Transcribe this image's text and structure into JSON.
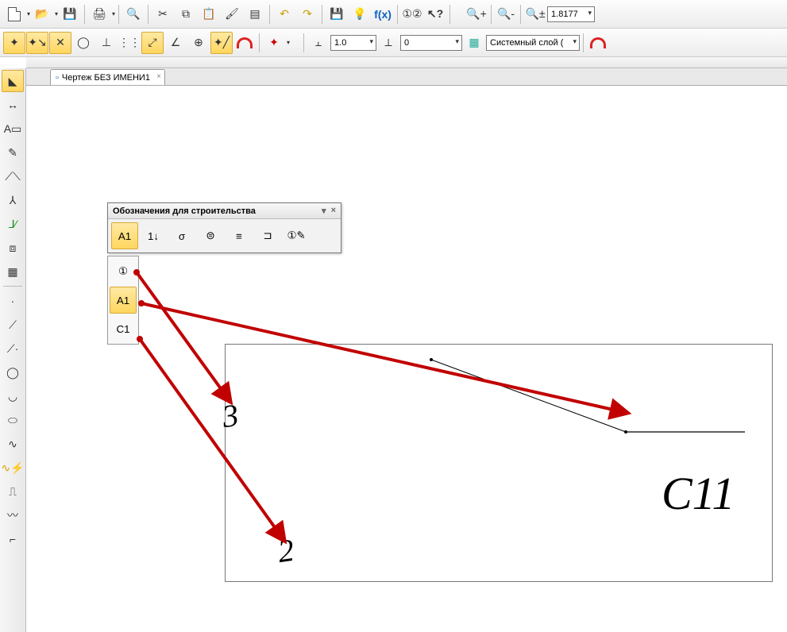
{
  "toolbar1": {
    "zoom_value": "1.8177"
  },
  "toolbar2": {
    "line_width": "1.0",
    "style_value": "0",
    "layer_label": "Системный слой ("
  },
  "tabs": [
    {
      "label": "Чертеж БЕЗ ИМЕНИ1"
    }
  ],
  "palette": {
    "title": "Обозначения для строительства",
    "items": [
      "A1",
      "1↓",
      "σ",
      "⊜",
      "≡",
      "⊐",
      "①✎"
    ]
  },
  "sub_palette": {
    "items": [
      "①",
      "A1",
      "C1"
    ]
  },
  "annotations": {
    "num3": "3",
    "num2": "2",
    "c11": "С11"
  }
}
